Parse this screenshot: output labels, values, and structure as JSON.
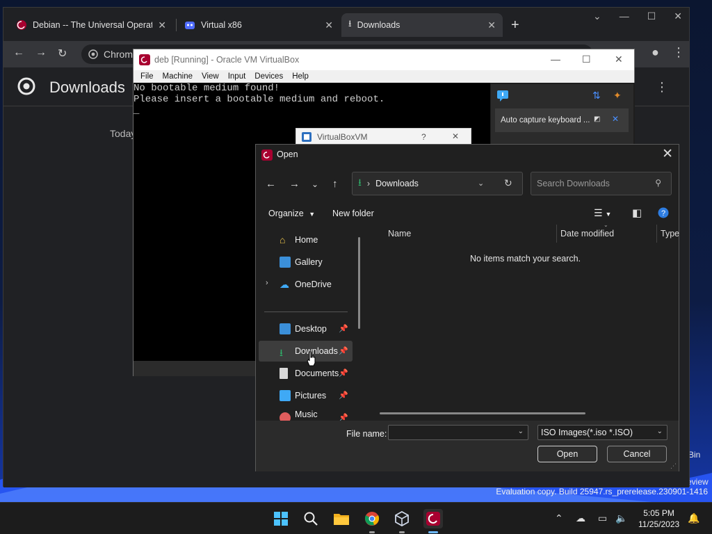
{
  "browser": {
    "tabs": [
      {
        "title": "Debian -- The Universal Operati"
      },
      {
        "title": "Virtual x86"
      },
      {
        "title": "Downloads"
      }
    ],
    "omnibox_text": "Chrome",
    "page_title": "Downloads",
    "today_label": "Today"
  },
  "virtualbox": {
    "title": "deb [Running] - Oracle VM VirtualBox",
    "menu": [
      "File",
      "Machine",
      "View",
      "Input",
      "Devices",
      "Help"
    ],
    "console_lines": [
      "No bootable medium found!",
      "Please insert a bootable medium and reboot."
    ],
    "notification": "Auto capture keyboard ...",
    "popup_title": "VirtualBoxVM",
    "popup_help": "?"
  },
  "dialog": {
    "title": "Open",
    "address_path": "Downloads",
    "search_placeholder": "Search Downloads",
    "organize_label": "Organize",
    "new_folder_label": "New folder",
    "nav_items": [
      {
        "label": "Home",
        "icon": "home-icon"
      },
      {
        "label": "Gallery",
        "icon": "gallery-icon"
      },
      {
        "label": "OneDrive",
        "icon": "onedrive-icon"
      },
      {
        "label": "Desktop",
        "icon": "desktop-icon"
      },
      {
        "label": "Downloads",
        "icon": "download-icon"
      },
      {
        "label": "Documents",
        "icon": "documents-icon"
      },
      {
        "label": "Pictures",
        "icon": "pictures-icon"
      },
      {
        "label": "Music",
        "icon": "music-icon"
      }
    ],
    "columns": [
      "Name",
      "Date modified",
      "Type"
    ],
    "empty_message": "No items match your search.",
    "file_name_label": "File name:",
    "file_name_value": "",
    "file_type_value": "ISO Images(*.iso *.ISO)",
    "open_label": "Open",
    "cancel_label": "Cancel"
  },
  "desktop": {
    "eval_text": "Evaluation copy. Build 25947.rs_prerelease.230901-1416",
    "peek_bin": "Bin",
    "peek_review": "eview"
  },
  "taskbar": {
    "time": "5:05 PM",
    "date": "11/25/2023"
  },
  "colors": {
    "accent": "#6cb8ff",
    "download_green": "#2fb26a"
  }
}
